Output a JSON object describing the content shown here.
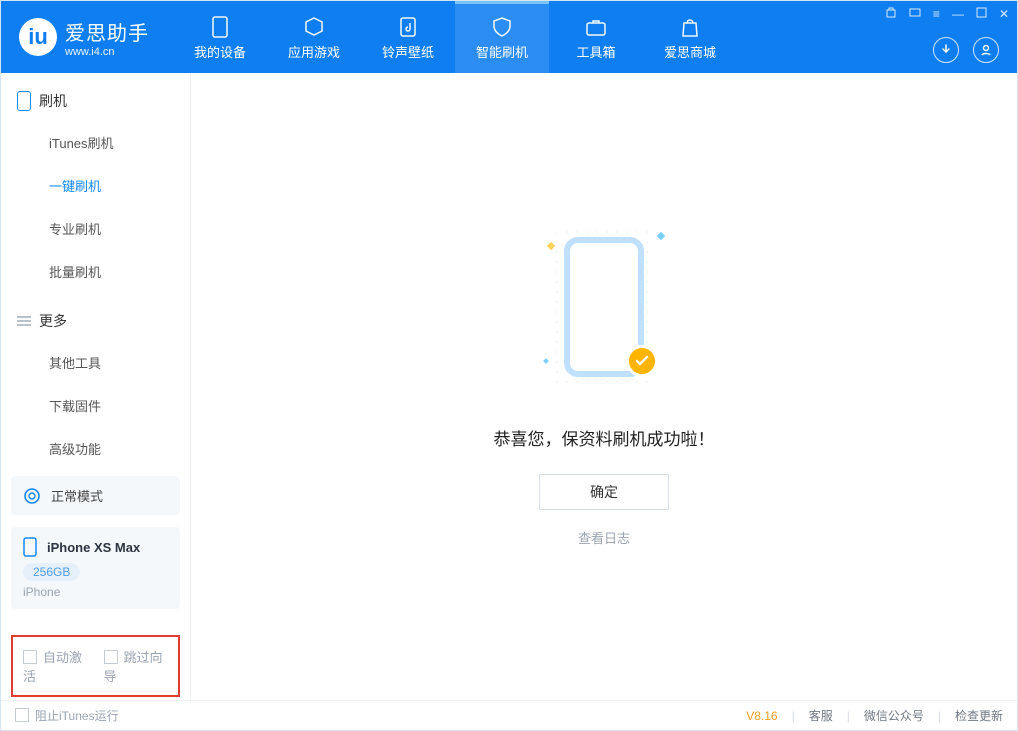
{
  "app": {
    "name": "爱思助手",
    "url": "www.i4.cn"
  },
  "nav": {
    "items": [
      {
        "label": "我的设备"
      },
      {
        "label": "应用游戏"
      },
      {
        "label": "铃声壁纸"
      },
      {
        "label": "智能刷机"
      },
      {
        "label": "工具箱"
      },
      {
        "label": "爱思商城"
      }
    ]
  },
  "sidebar": {
    "section1_title": "刷机",
    "section1": [
      {
        "label": "iTunes刷机"
      },
      {
        "label": "一键刷机"
      },
      {
        "label": "专业刷机"
      },
      {
        "label": "批量刷机"
      }
    ],
    "section2_title": "更多",
    "section2": [
      {
        "label": "其他工具"
      },
      {
        "label": "下载固件"
      },
      {
        "label": "高级功能"
      }
    ],
    "mode_label": "正常模式",
    "device": {
      "name": "iPhone XS Max",
      "storage": "256GB",
      "type": "iPhone"
    },
    "auto_activate": "自动激活",
    "skip_wizard": "跳过向导"
  },
  "main": {
    "success_msg": "恭喜您，保资料刷机成功啦！",
    "ok_btn": "确定",
    "view_log": "查看日志"
  },
  "footer": {
    "block_itunes": "阻止iTunes运行",
    "version": "V8.16",
    "support": "客服",
    "wechat": "微信公众号",
    "check_update": "检查更新"
  }
}
